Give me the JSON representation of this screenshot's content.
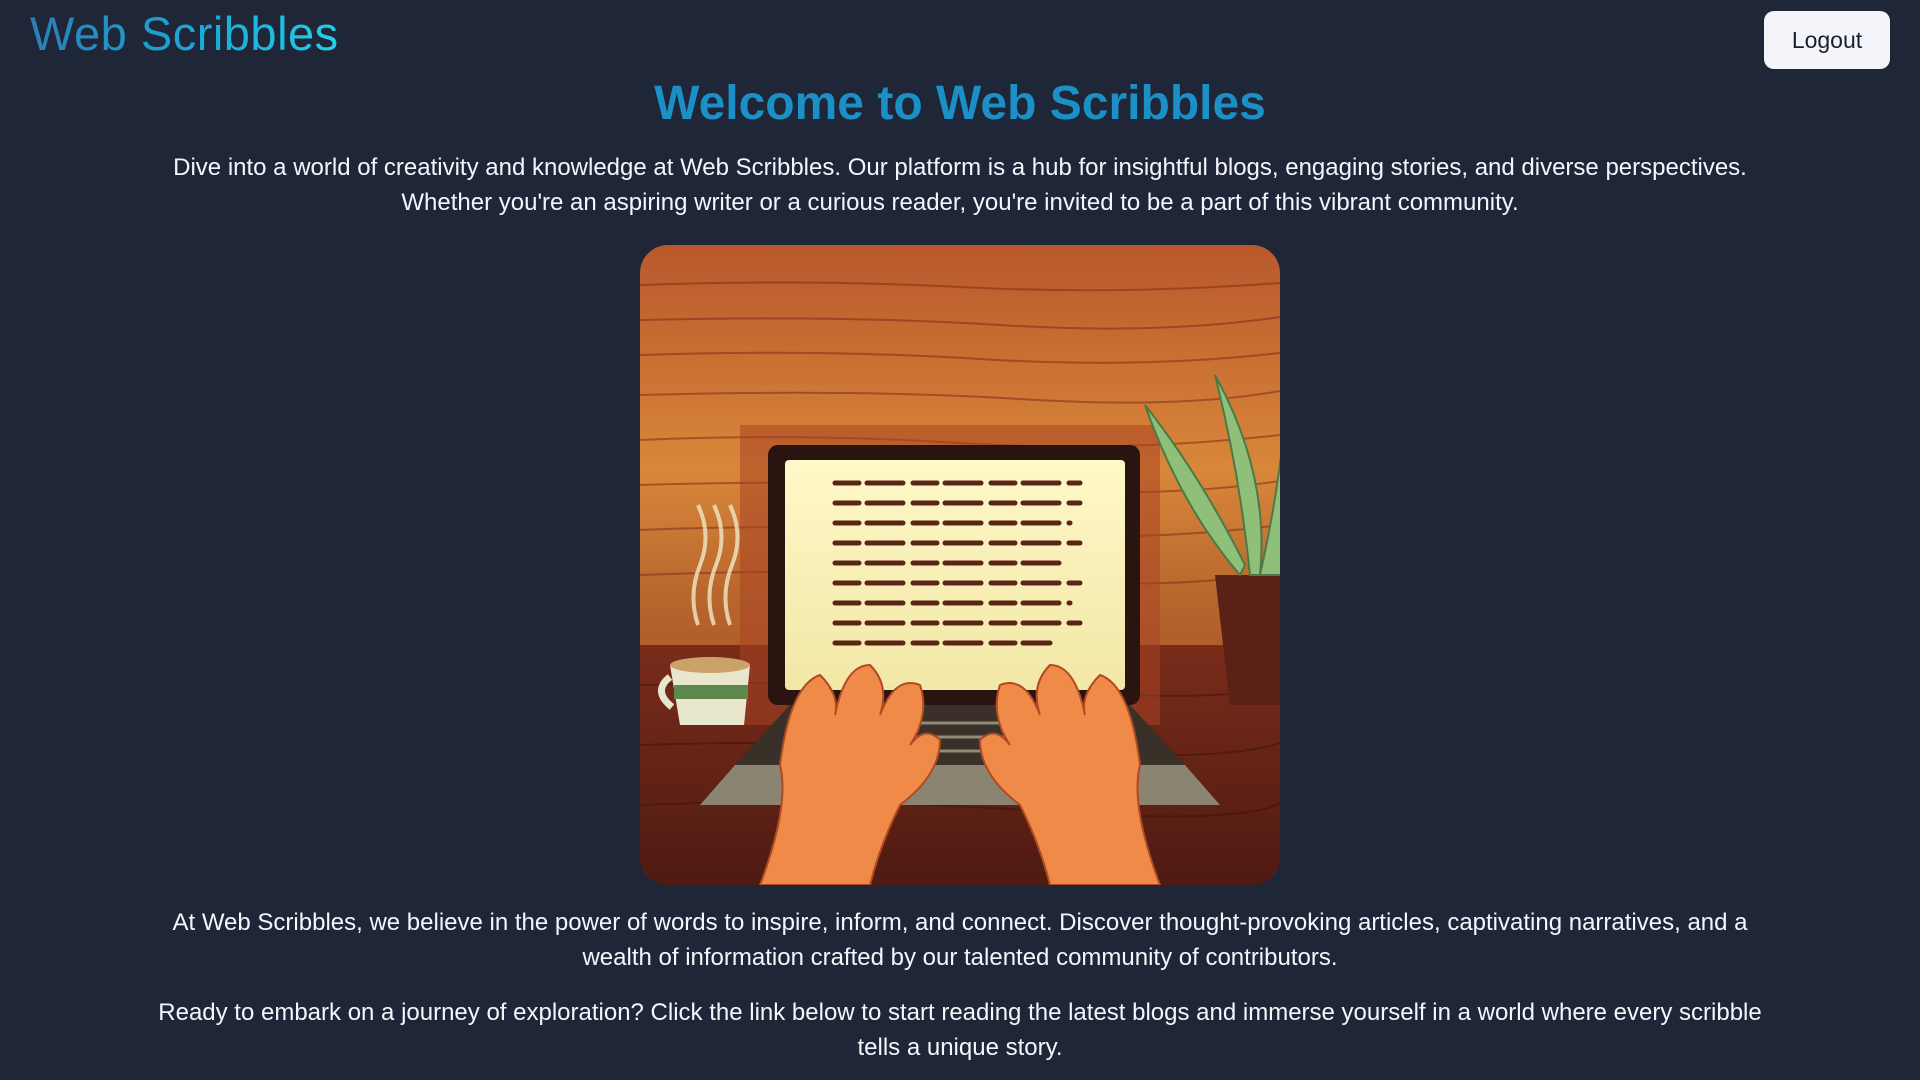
{
  "header": {
    "logo_text": "Web Scribbles",
    "logout_label": "Logout"
  },
  "main": {
    "title": "Welcome to Web Scribbles",
    "intro": "Dive into a world of creativity and knowledge at Web Scribbles. Our platform is a hub for insightful blogs, engaging stories, and diverse perspectives. Whether you're an aspiring writer or a curious reader, you're invited to be a part of this vibrant community.",
    "hero_image": "illustration of hands typing on a laptop beside a coffee cup and plant",
    "body": "At Web Scribbles, we believe in the power of words to inspire, inform, and connect. Discover thought-provoking articles, captivating narratives, and a wealth of information crafted by our talented community of contributors.",
    "cta": "Ready to embark on a journey of exploration? Click the link below to start reading the latest blogs and immerse yourself in a world where every scribble tells a unique story."
  },
  "colors": {
    "background": "#1e2638",
    "title": "#1a90c6",
    "logo_gradient_start": "#2a7fb5",
    "logo_gradient_end": "#22d0e6",
    "button_bg": "#f3f5fa"
  }
}
